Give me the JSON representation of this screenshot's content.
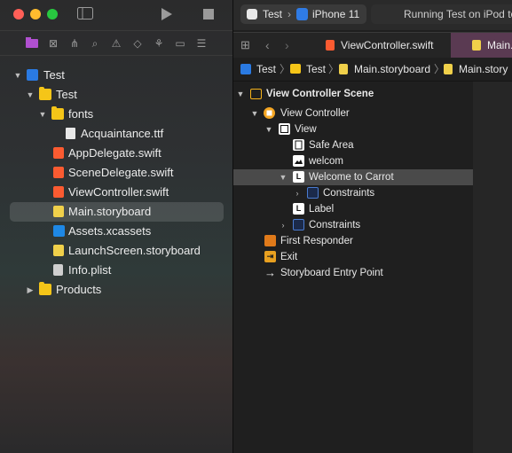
{
  "window": {
    "toolbar": {
      "play_icon": "play-icon",
      "stop_icon": "stop-icon",
      "sidebar_toggle_icon": "sidebar-toggle-icon"
    }
  },
  "navigator": {
    "tree": [
      {
        "label": "Test",
        "icon": "project-icon"
      },
      {
        "label": "Test",
        "icon": "folder-icon"
      },
      {
        "label": "fonts",
        "icon": "folder-icon"
      },
      {
        "label": "Acquaintance.ttf",
        "icon": "file-icon"
      },
      {
        "label": "AppDelegate.swift",
        "icon": "swift-file-icon"
      },
      {
        "label": "SceneDelegate.swift",
        "icon": "swift-file-icon"
      },
      {
        "label": "ViewController.swift",
        "icon": "swift-file-icon"
      },
      {
        "label": "Main.storyboard",
        "icon": "storyboard-file-icon",
        "selected": true
      },
      {
        "label": "Assets.xcassets",
        "icon": "asset-catalog-icon"
      },
      {
        "label": "LaunchScreen.storyboard",
        "icon": "storyboard-file-icon"
      },
      {
        "label": "Info.plist",
        "icon": "plist-file-icon"
      },
      {
        "label": "Products",
        "icon": "folder-icon"
      }
    ]
  },
  "editor": {
    "scheme": {
      "target": "Test",
      "device": "iPhone 11"
    },
    "status": "Running Test on iPod to",
    "tabs": [
      {
        "label": "ViewController.swift"
      },
      {
        "label": "Main."
      }
    ],
    "jumpbar": [
      "Test",
      "Test",
      "Main.storyboard",
      "Main.story"
    ],
    "outline": [
      {
        "label": "View Controller Scene",
        "bold": true
      },
      {
        "label": "View Controller"
      },
      {
        "label": "View"
      },
      {
        "label": "Safe Area"
      },
      {
        "label": "welcom"
      },
      {
        "label": "Welcome to Carrot",
        "selected": true
      },
      {
        "label": "Constraints"
      },
      {
        "label": "Label"
      },
      {
        "label": "Constraints"
      },
      {
        "label": "First Responder"
      },
      {
        "label": "Exit"
      },
      {
        "label": "Storyboard Entry Point"
      }
    ]
  },
  "colors": {
    "accent_selection": "#4a4a4a",
    "folder": "#f5c518",
    "swift": "#fb5b31"
  }
}
